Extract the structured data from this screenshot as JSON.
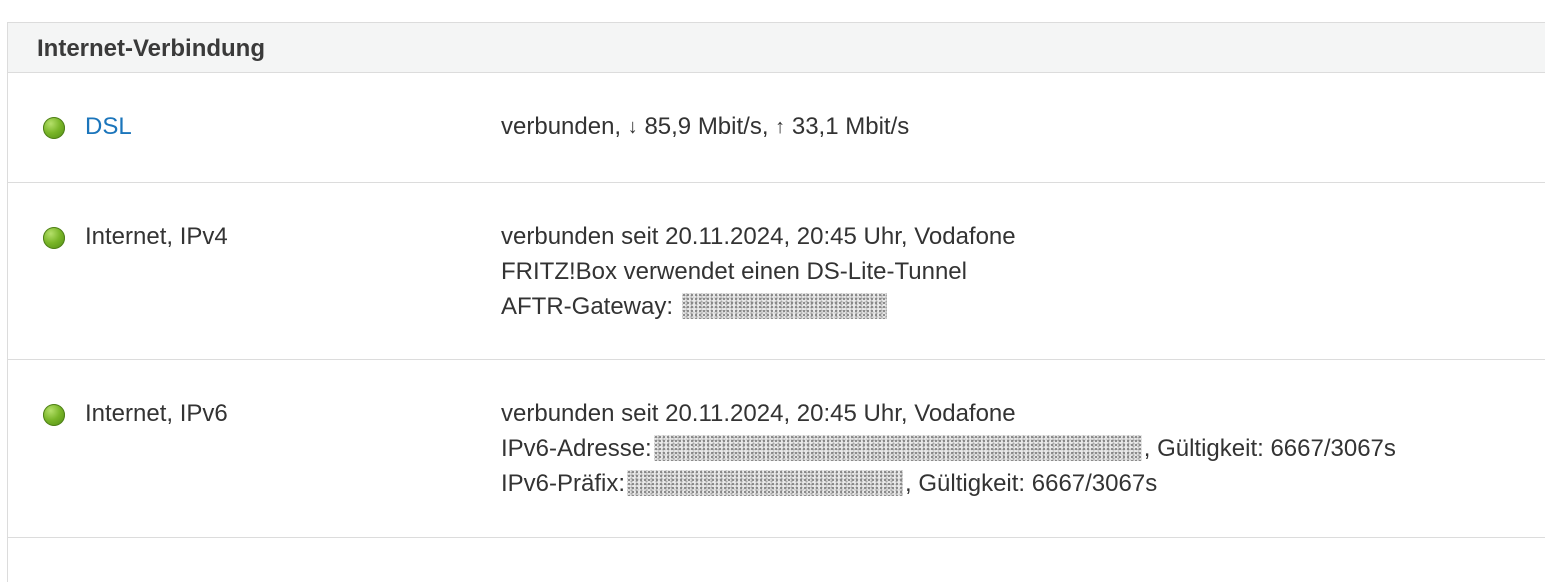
{
  "panel": {
    "title": "Internet-Verbindung"
  },
  "rows": {
    "dsl": {
      "status_color": "#7ab629",
      "label": "DSL",
      "status": "verbunden,",
      "down_arrow": "↓",
      "down_rate": "85,9 Mbit/s,",
      "up_arrow": "↑",
      "up_rate": "33,1 Mbit/s"
    },
    "ipv4": {
      "status_color": "#7ab629",
      "label": "Internet, IPv4",
      "line1": "verbunden seit 20.11.2024, 20:45 Uhr, Vodafone",
      "line2": "FRITZ!Box verwendet einen DS-Lite-Tunnel",
      "gateway_label": "AFTR-Gateway:"
    },
    "ipv6": {
      "status_color": "#7ab629",
      "label": "Internet, IPv6",
      "line1": "verbunden seit 20.11.2024, 20:45 Uhr, Vodafone",
      "address_label": "IPv6-Adresse:",
      "address_validity": ", Gültigkeit: 6667/3067s",
      "prefix_label": "IPv6-Präfix:",
      "prefix_validity": ", Gültigkeit: 6667/3067s"
    }
  }
}
